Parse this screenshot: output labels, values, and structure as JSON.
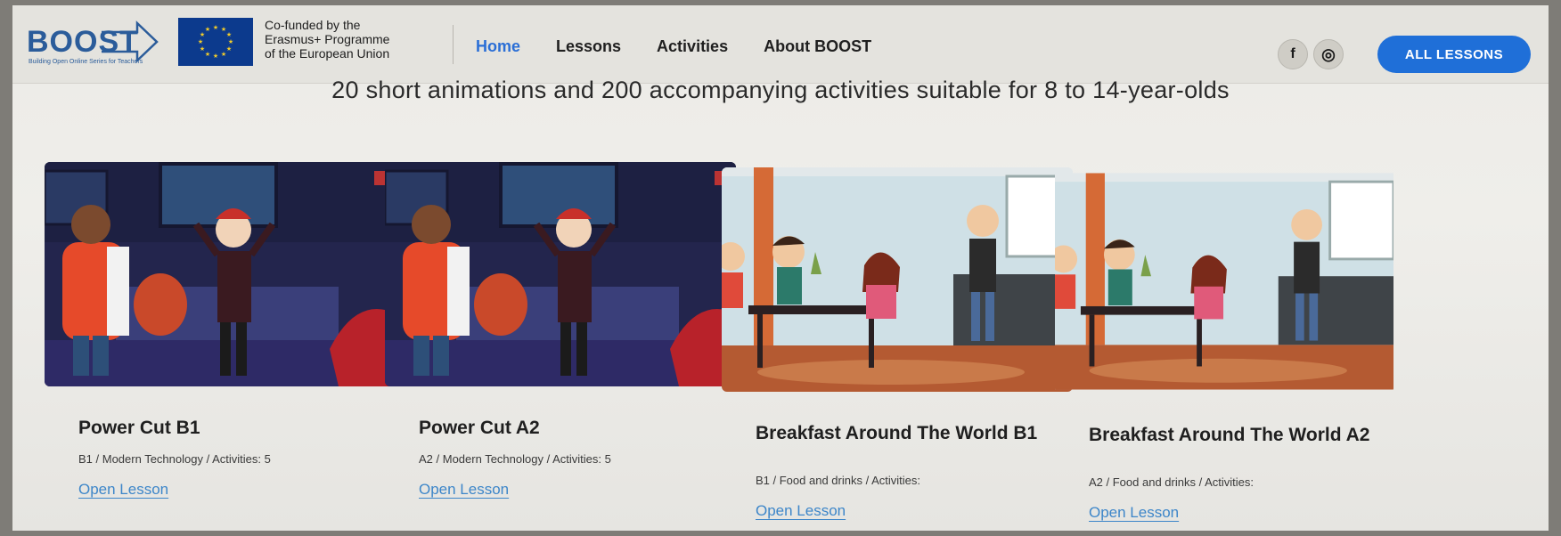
{
  "brand": {
    "logo_text": "BOOST",
    "logo_tagline": "Building Open Online Series for Teachers",
    "eu_lines": [
      "Co-funded by the",
      "Erasmus+ Programme",
      "of the European Union"
    ]
  },
  "nav": {
    "items": [
      {
        "label": "Home",
        "active": true
      },
      {
        "label": "Lessons",
        "active": false
      },
      {
        "label": "Activities",
        "active": false
      },
      {
        "label": "About BOOST",
        "active": false
      }
    ]
  },
  "social": {
    "facebook": "f",
    "instagram": "◎"
  },
  "all_lessons_button": "ALL LESSONS",
  "subtitle": "20 short animations and 200 accompanying activities suitable for 8 to 14-year-olds",
  "cards": [
    {
      "title": "Power Cut B1",
      "meta": "B1 / Modern Technology / Activities: 5",
      "link": "Open Lesson"
    },
    {
      "title": "Power Cut A2",
      "meta": "A2 / Modern Technology / Activities: 5",
      "link": "Open Lesson"
    },
    {
      "title": "Breakfast Around The World B1",
      "meta": "B1 / Food and drinks / Activities:",
      "link": "Open Lesson"
    },
    {
      "title": "Breakfast Around The World A2",
      "meta": "A2 / Food and drinks / Activities:",
      "link": "Open Lesson"
    }
  ],
  "colors": {
    "accent": "#1f6fd8",
    "link": "#3d86c9",
    "brand": "#2b5c9a"
  }
}
